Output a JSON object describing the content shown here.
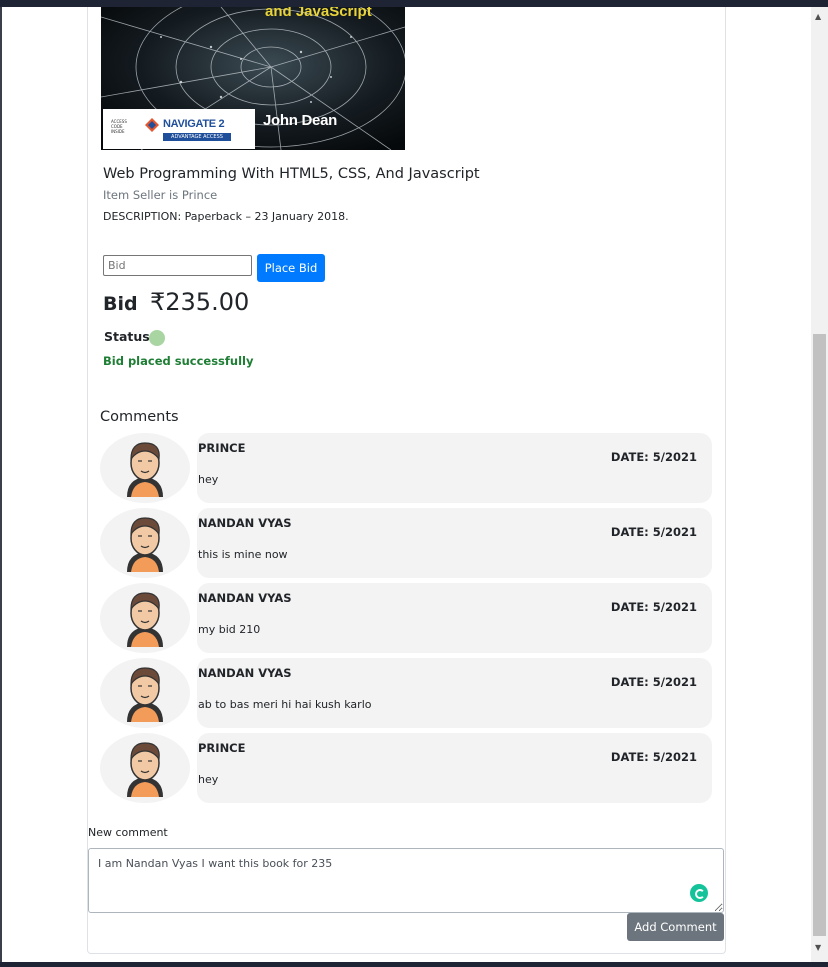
{
  "book": {
    "cover": {
      "title_text": "and JavaScript",
      "badge_small_text": "ACCESS CODE INSIDE",
      "badge_brand": "NAVIGATE 2",
      "badge_sub": "ADVANTAGE ACCESS",
      "author": "John Dean"
    },
    "title": "Web Programming With HTML5, CSS, And Javascript",
    "seller": "Item Seller is Prince",
    "description": "DESCRIPTION: Paperback – 23 January 2018."
  },
  "bid_form": {
    "placeholder": "Bid",
    "button_label": "Place Bid"
  },
  "bid": {
    "label": "Bid",
    "amount": "₹235.00"
  },
  "status": {
    "label": "Status",
    "message": "Bid placed successfully",
    "color": "#a8d5a2"
  },
  "comments": {
    "heading": "Comments",
    "items": [
      {
        "name": "PRINCE",
        "date": "DATE: 5/2021",
        "text": "hey"
      },
      {
        "name": "NANDAN VYAS",
        "date": "DATE: 5/2021",
        "text": "this is mine now"
      },
      {
        "name": "NANDAN VYAS",
        "date": "DATE: 5/2021",
        "text": "my bid 210"
      },
      {
        "name": "NANDAN VYAS",
        "date": "DATE: 5/2021",
        "text": "ab to bas meri hi hai kush karlo"
      },
      {
        "name": "PRINCE",
        "date": "DATE: 5/2021",
        "text": "hey"
      }
    ]
  },
  "new_comment": {
    "label": "New comment",
    "value": "I am Nandan Vyas I want this book for 235",
    "button_label": "Add Comment"
  },
  "colors": {
    "primary": "#007bff",
    "secondary": "#6c757d",
    "success_text": "#1e7e34",
    "bubble": "#f3f3f3"
  }
}
